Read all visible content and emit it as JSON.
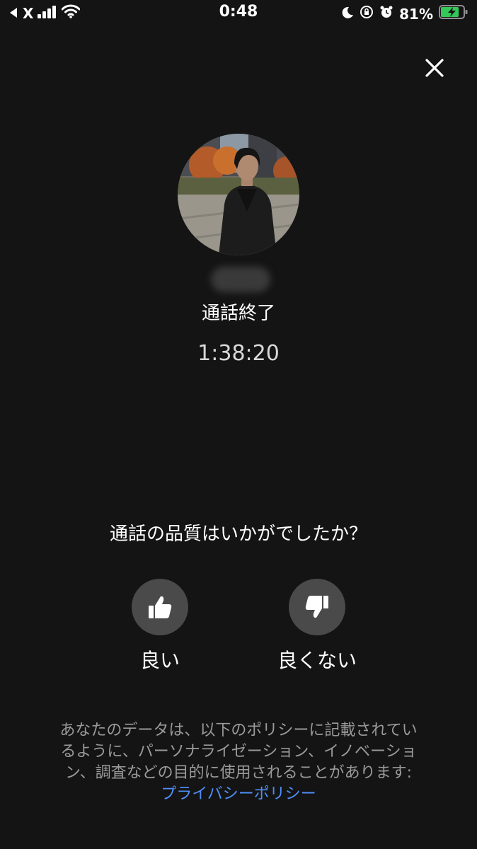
{
  "status_bar": {
    "back_app": "X",
    "time": "0:48",
    "battery_percent": "81%",
    "battery_level": 0.81
  },
  "call": {
    "status": "通話終了",
    "duration": "1:38:20"
  },
  "rating": {
    "question": "通話の品質はいかがでしたか？",
    "good_label": "良い",
    "bad_label": "良くない"
  },
  "disclaimer": {
    "text": "あなたのデータは、以下のポリシーに記載されているように、パーソナライゼーション、イノベーション、調査などの目的に使用されることがあります:",
    "privacy_link": "プライバシーポリシー"
  },
  "colors": {
    "background": "#141414",
    "button_bg": "#4a4a4a",
    "link": "#4f8ef7",
    "battery_charging": "#35c759"
  }
}
